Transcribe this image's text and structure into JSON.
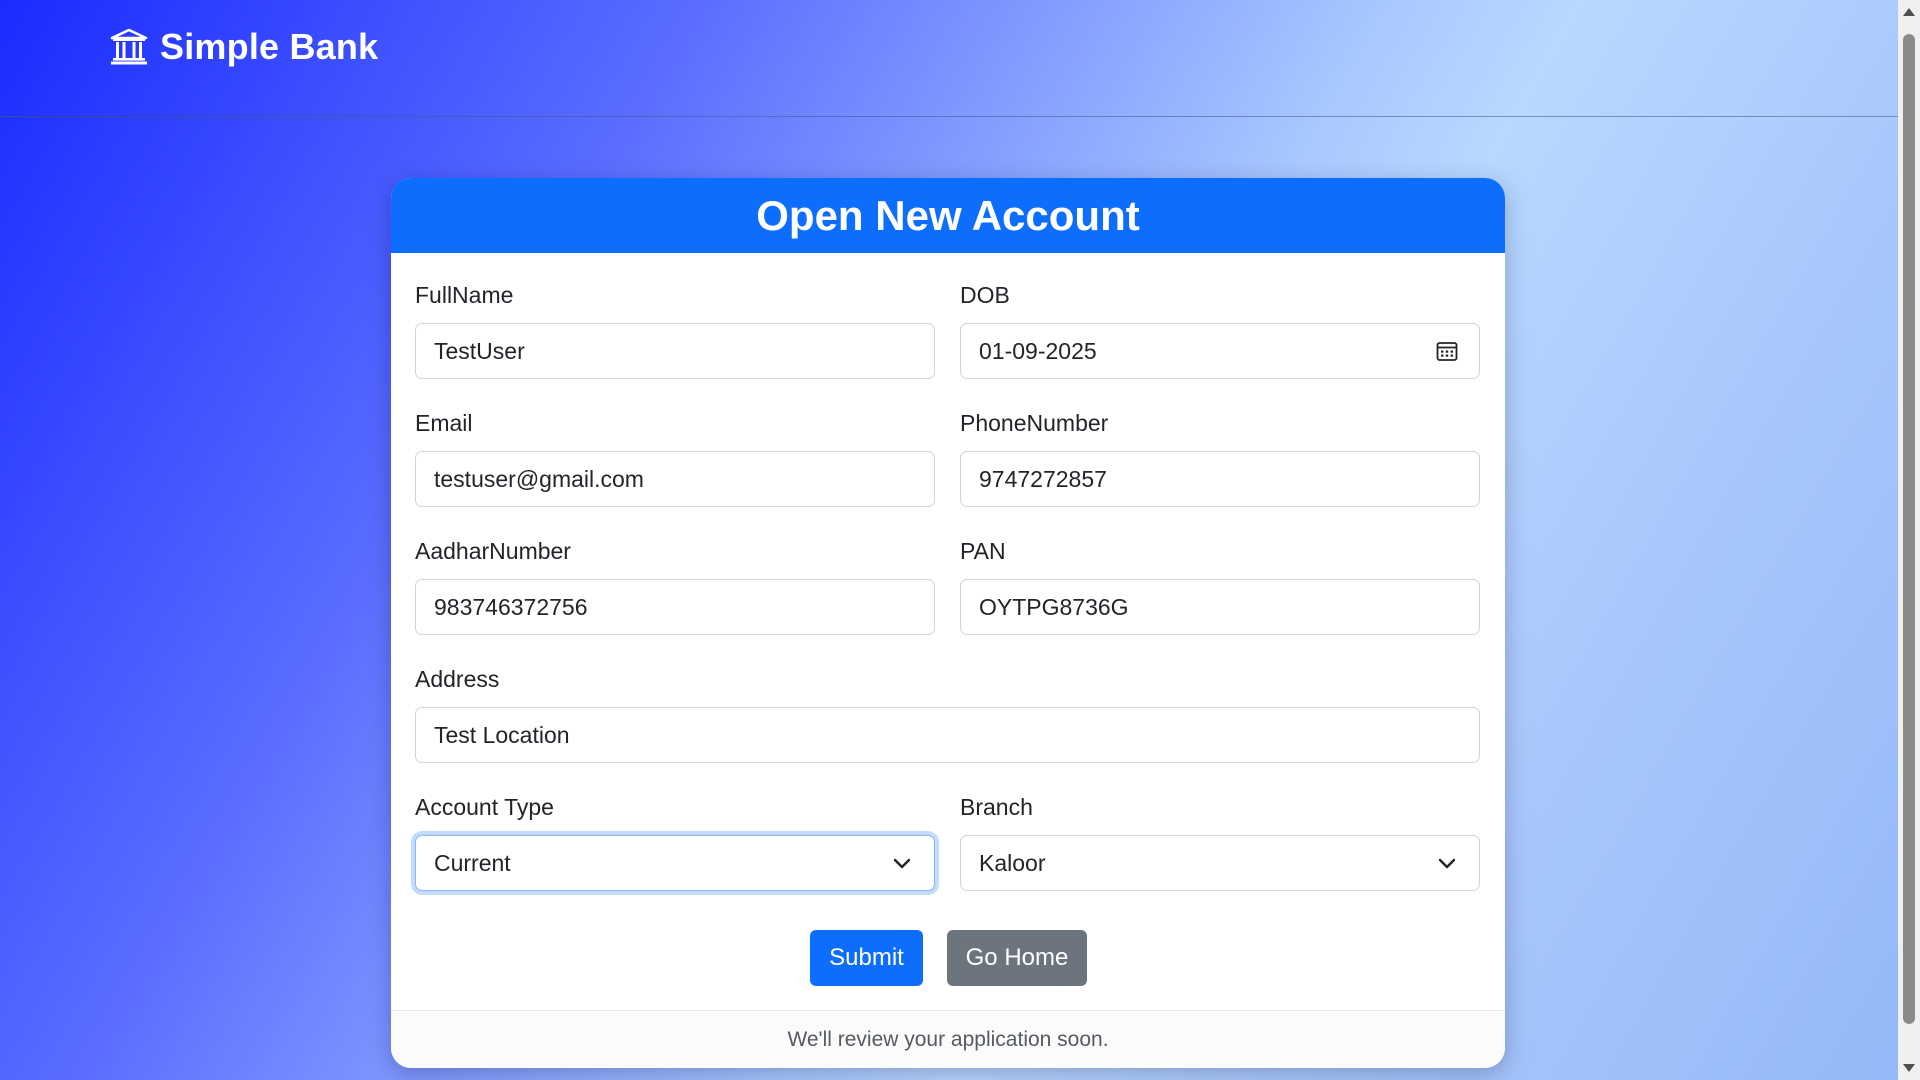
{
  "navbar": {
    "brand_name": "Simple Bank",
    "brand_icon": "bank-icon"
  },
  "form": {
    "title": "Open New Account",
    "fields": {
      "fullname": {
        "label": "FullName",
        "value": "TestUser"
      },
      "dob": {
        "label": "DOB",
        "value": "01-09-2025",
        "icon": "calendar-icon"
      },
      "email": {
        "label": "Email",
        "value": "testuser@gmail.com"
      },
      "phone": {
        "label": "PhoneNumber",
        "value": "9747272857"
      },
      "aadhar": {
        "label": "AadharNumber",
        "value": "983746372756"
      },
      "pan": {
        "label": "PAN",
        "value": "OYTPG8736G"
      },
      "address": {
        "label": "Address",
        "value": "Test Location"
      },
      "account_type": {
        "label": "Account Type",
        "selected": "Current",
        "icon": "chevron-down-icon"
      },
      "branch": {
        "label": "Branch",
        "selected": "Kaloor",
        "icon": "chevron-down-icon"
      }
    },
    "buttons": {
      "submit": "Submit",
      "go_home": "Go Home"
    },
    "footer_text": "We'll review your application soon."
  },
  "colors": {
    "primary": "#0d6efd",
    "secondary": "#6c757d",
    "background_gradient": [
      "#1a2bff",
      "#b8d8ff",
      "#93b8f8"
    ]
  }
}
